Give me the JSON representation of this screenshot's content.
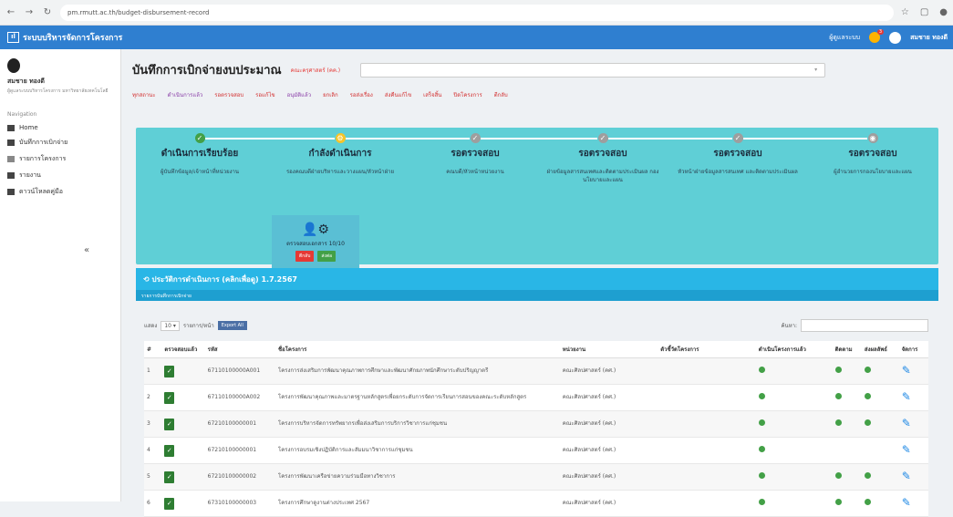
{
  "browser": {
    "url": "pm.rmutt.ac.th/budget-disbursement-record"
  },
  "topbar": {
    "app_title": "ระบบบริหารจัดการโครงการ",
    "role_label": "ผู้ดูแลระบบ",
    "notif_count": "3",
    "user_name": "สมชาย ทองดี"
  },
  "sidebar": {
    "user_name": "สมชาย ทองดี",
    "user_sub": "ผู้ดูแลระบบบริหารโครงการ\nมหาวิทยาลัยเทคโนโลยี",
    "nav_title": "Navigation",
    "items": [
      {
        "label": "Home"
      },
      {
        "label": "บันทึกการเบิกจ่าย"
      },
      {
        "label": "รายการโครงการ"
      },
      {
        "label": "รายงาน"
      },
      {
        "label": "ดาวน์โหลดคู่มือ"
      }
    ]
  },
  "page": {
    "title": "บันทึกการเบิกจ่ายงบประมาณ",
    "title_tag": "คณะครุศาสตร์ (คค.)",
    "select_value": "",
    "tabs": [
      "ทุกสถานะ",
      "ดำเนินการแล้ว",
      "รอตรวจสอบ",
      "รอแก้ไข",
      "อนุมัติแล้ว",
      "ยกเลิก",
      "รอส่งเรื่อง",
      "ส่งคืนแก้ไข",
      "เสร็จสิ้น",
      "ปิดโครงการ",
      "ตีกลับ"
    ]
  },
  "workflow": {
    "steps": [
      {
        "title": "ดำเนินการเรียบร้อย",
        "desc": "ผู้บันทึกข้อมูล/เจ้าหน้าที่หน่วยงาน",
        "icon": "✓",
        "color": "#43a047"
      },
      {
        "title": "กำลังดำเนินการ",
        "desc": "รองคณบดีฝ่ายบริหารและวางแผน/หัวหน้าฝ่าย",
        "icon": "⚙",
        "color": "#f6c42a"
      },
      {
        "title": "รอตรวจสอบ",
        "desc": "คณบดี/หัวหน้าหน่วยงาน",
        "icon": "✓",
        "color": "#9e9e9e"
      },
      {
        "title": "รอตรวจสอบ",
        "desc": "ฝ่ายข้อมูลสารสนเทศและติดตามประเมินผล กองนโยบายและแผน",
        "icon": "✓",
        "color": "#9e9e9e"
      },
      {
        "title": "รอตรวจสอบ",
        "desc": "หัวหน้าฝ่ายข้อมูลสารสนเทศ และติดตามประเมินผล",
        "icon": "✓",
        "color": "#9e9e9e"
      },
      {
        "title": "รอตรวจสอบ",
        "desc": "ผู้อำนวยการกองนโยบายและแผน",
        "icon": "◉",
        "color": "#9e9e9e"
      }
    ],
    "card_text": "ตรวจสอบเอกสาร 10/10",
    "card_btn_back": "ตีกลับ",
    "card_btn_send": "ส่งต่อ"
  },
  "history": {
    "title": "ประวัติการดำเนินการ (คลิกเพื่อดู) 1.7.2567",
    "subtitle": "รายการบันทึกการเบิกจ่าย"
  },
  "table_ctrl": {
    "show_label": "แสดง",
    "page_size": "10",
    "rows_label": "รายการ/หน้า",
    "export_label": "Export All",
    "search_label": "ค้นหา:"
  },
  "table": {
    "headers": [
      "#",
      "ตรวจสอบแล้ว",
      "รหัส",
      "ชื่อโครงการ",
      "หน่วยงาน",
      "ตัวชี้วัดโครงการ",
      "ดำเนินโครงการแล้ว",
      "ติดตาม",
      "ส่งผลลัพธ์",
      "จัดการ"
    ],
    "rows": [
      {
        "n": "1",
        "code": "67110100000A001",
        "name": "โครงการส่งเสริมการพัฒนาคุณภาพการศึกษาและพัฒนาศักยภาพนักศึกษาระดับปริญญาตรี",
        "dept": "คณะศิลปศาสตร์ (คศ.)",
        "c1": true,
        "c2": true,
        "c3": true
      },
      {
        "n": "2",
        "code": "67110100000A002",
        "name": "โครงการพัฒนาคุณภาพและมาตรฐานหลักสูตรเพื่อยกระดับการจัดการเรียนการสอนของคณะระดับหลักสูตร",
        "dept": "คณะศิลปศาสตร์ (คศ.)",
        "c1": true,
        "c2": true,
        "c3": true
      },
      {
        "n": "3",
        "code": "67210100000001",
        "name": "โครงการบริหารจัดการทรัพยากรเพื่อส่งเสริมการบริการวิชาการแก่ชุมชน",
        "dept": "คณะศิลปศาสตร์ (คศ.)",
        "c1": true,
        "c2": true,
        "c3": true
      },
      {
        "n": "4",
        "code": "67210100000001",
        "name": "โครงการอบรมเชิงปฏิบัติการและสัมมนาวิชาการแก่ชุมชน",
        "dept": "คณะศิลปศาสตร์ (คศ.)",
        "c1": true,
        "c2": false,
        "c3": false
      },
      {
        "n": "5",
        "code": "67210100000002",
        "name": "โครงการพัฒนาเครือข่ายความร่วมมือทางวิชาการ",
        "dept": "คณะศิลปศาสตร์ (คศ.)",
        "c1": true,
        "c2": true,
        "c3": true
      },
      {
        "n": "6",
        "code": "67310100000003",
        "name": "โครงการศึกษาดูงานต่างประเทศ 2567",
        "dept": "คณะศิลปศาสตร์ (คศ.)",
        "c1": true,
        "c2": true,
        "c3": true
      }
    ]
  }
}
